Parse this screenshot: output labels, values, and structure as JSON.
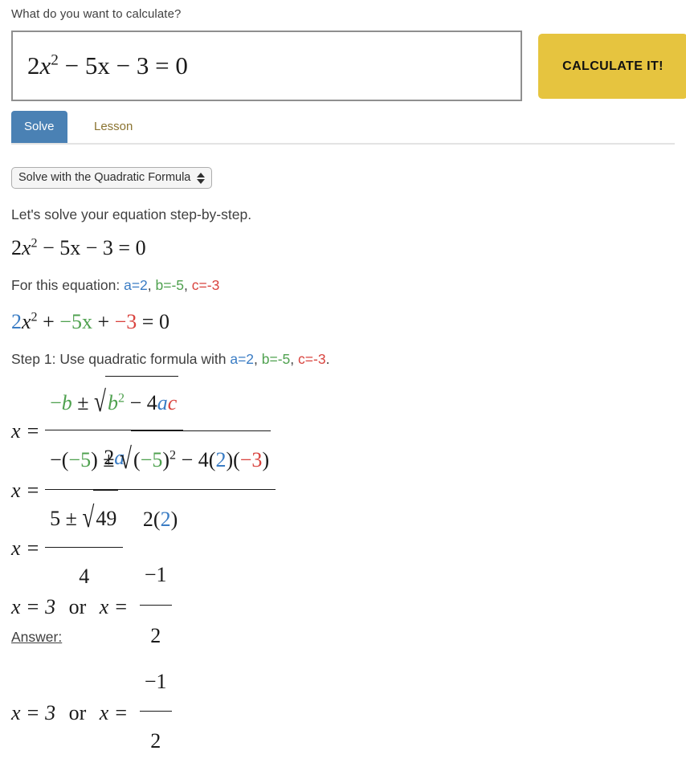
{
  "header": {
    "prompt_label": "What do you want to calculate?"
  },
  "input": {
    "value_plain": "2x^2 - 5x - 3 = 0",
    "coef_a": "2",
    "x_sym": "x",
    "exp_2": "2",
    "minus_5x": "− 5x − 3 = 0"
  },
  "toolbar": {
    "calculate_label": "CALCULATE IT!"
  },
  "tabs": [
    {
      "label": "Solve",
      "active": true
    },
    {
      "label": "Lesson",
      "active": false
    }
  ],
  "method_select": {
    "selected": "Solve with the Quadratic Formula",
    "icon": "updown-arrows-icon"
  },
  "solution": {
    "intro": "Let's solve your equation step-by-step.",
    "equation": {
      "lhs_coef": "2",
      "var": "x",
      "exp": "2",
      "rest": "− 5x − 3 = 0"
    },
    "for_this_equation_label": "For this equation:",
    "coefficients": {
      "a": "a=2",
      "b": "b=-5",
      "c": "c=-3",
      "sep": ", "
    },
    "colored_equation": {
      "a_coef": "2",
      "var_x": "x",
      "exp": "2",
      "plus1": " + ",
      "b_term": "−5x",
      "plus2": " + ",
      "c_term": "−3",
      "eq_zero": " = 0"
    },
    "step1": {
      "prefix": "Step 1: Use quadratic formula with ",
      "a": "a=2",
      "b": "b=-5",
      "c": "c=-3",
      "suffix": "."
    },
    "formula_generic": {
      "x_eq": "x =",
      "num_minus": "−",
      "num_b": "b",
      "pm": "±",
      "radical": "√",
      "rad_b": "b",
      "rad_exp": "2",
      "rad_minus4": "− 4",
      "rad_a": "a",
      "rad_c": "c",
      "den_2": "2",
      "den_a": "a"
    },
    "formula_substituted": {
      "x_eq": "x =",
      "num_minus": "−(",
      "num_b": "−5",
      "num_close": ")",
      "pm": "±",
      "radical": "√",
      "rad_open": "(",
      "rad_b": "−5",
      "rad_close": ")",
      "rad_exp": "2",
      "rad_minus4": "− 4(",
      "rad_a": "2",
      "rad_mid": ")(",
      "rad_c": "−3",
      "rad_end": ")",
      "den": "2(",
      "den_a": "2",
      "den_end": ")"
    },
    "formula_simplified": {
      "x_eq": "x =",
      "num_5": "5",
      "pm": "±",
      "radical": "√",
      "radicand": "49",
      "den": "4"
    },
    "roots": {
      "x_eq": "x = 3",
      "or": "or",
      "x_eq2": "x =",
      "num": "−1",
      "den": "2"
    },
    "answer_label": "Answer:",
    "answer_roots": {
      "x_eq": "x = 3",
      "or": "or",
      "x_eq2": "x =",
      "num": "−1",
      "den": "2"
    }
  },
  "colors": {
    "accent_blue": "#3a7cc4",
    "accent_green": "#4fa14f",
    "accent_red": "#d9443f",
    "button_yellow": "#e6c43f",
    "tab_active_blue": "#4a81b4",
    "tab_inactive_olive": "#8a7330"
  }
}
